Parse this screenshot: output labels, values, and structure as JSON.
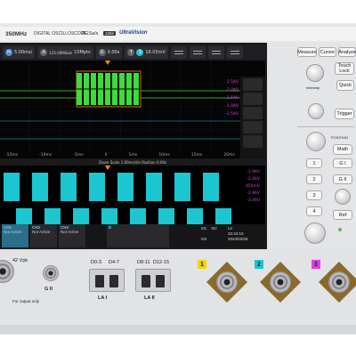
{
  "header": {
    "model": "350MHz",
    "description": "DIGITAL OSCILLOSCOPE",
    "sample_rate": "2GSa/s",
    "bits": "12bit",
    "brand": "UltraVision"
  },
  "screen": {
    "timebase": "5.00ms/",
    "acq_rate": "125.00MSa/s",
    "acq_points": "10Mpts",
    "trigger_pos": "0.00s",
    "trigger_level": "16.05mV",
    "trigger_channel": "3",
    "zoom_time_labels": [
      "-15ms",
      "-10ms",
      "-5ms",
      "0",
      "5ms",
      "10ms",
      "15ms",
      "20ms"
    ],
    "zoom_right_labels": [
      "2.54V",
      "2.04V",
      "1.54V",
      "1.04V",
      "-1.54V"
    ],
    "info_bar": "Zoom  Scale 1.00ms/div  Position 0.00s",
    "main_right_labels": [
      "-1.96V",
      "-2.46V",
      "-2.96V",
      "-3.46V"
    ],
    "main_time_labels": [
      "-5ms",
      "-3ms",
      "-2ms",
      "-1ms",
      "0",
      "1ms",
      "2ms",
      "3ms",
      "4ms"
    ],
    "mid_right_label": "450mV",
    "channels": [
      {
        "name": "CH1",
        "sub": "Not Active"
      },
      {
        "name": "CH2",
        "sub": "Not Active"
      },
      {
        "name": "CH3",
        "sub": "Not Active"
      },
      {
        "name": "D",
        "sub": ""
      }
    ],
    "trigger_box": {
      "label": "LV",
      "value": "22:44:10",
      "date": "2024/03/25"
    },
    "ms_labels": [
      "M1",
      "M2",
      "M3"
    ]
  },
  "panel": {
    "buttons_top": [
      "Measure",
      "Cursor",
      "Analyze"
    ],
    "touch_lock": "Touch Lock",
    "quick": "Quick",
    "intensity": "Intensity",
    "trigger": "Trigger",
    "position": "POSITION",
    "math": "Math",
    "ch_buttons": [
      "1",
      "2",
      "3",
      "4"
    ],
    "ref": "Ref"
  },
  "front": {
    "vpk": "42 Vpk",
    "gnd": "G II",
    "output_only": "For output only",
    "la_group1": "D0-3",
    "la_group2": "D4-7",
    "la_group3": "D8-11",
    "la_group4": "D12-15",
    "la_label1": "LA I",
    "la_label2": "LA II",
    "ch_numbers": [
      "1",
      "2",
      "3"
    ],
    "ch_colors": [
      "#f2d400",
      "#19c7d1",
      "#e040e0"
    ]
  },
  "colors": {
    "wave_green": "#3ddc3a",
    "wave_cyan": "#1bc6d0",
    "orange": "#ff8a00"
  }
}
